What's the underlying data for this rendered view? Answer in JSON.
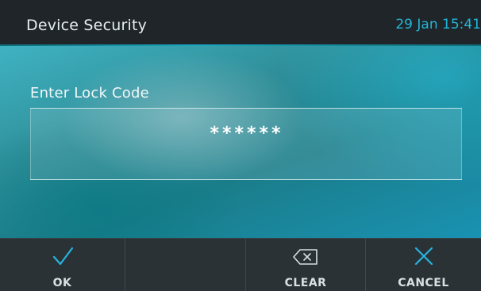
{
  "header": {
    "title": "Device Security",
    "clock": "29 Jan 15:41"
  },
  "prompt": {
    "label": "Enter Lock Code",
    "masked_value": "******"
  },
  "softkeys": [
    {
      "label": "OK",
      "icon": "check-icon"
    },
    {
      "label": "",
      "icon": ""
    },
    {
      "label": "CLEAR",
      "icon": "backspace-icon"
    },
    {
      "label": "CANCEL",
      "icon": "close-icon"
    }
  ],
  "colors": {
    "accent": "#22b6d8",
    "title_bar": "#1f2528",
    "softkey_bar": "#2a3236"
  }
}
